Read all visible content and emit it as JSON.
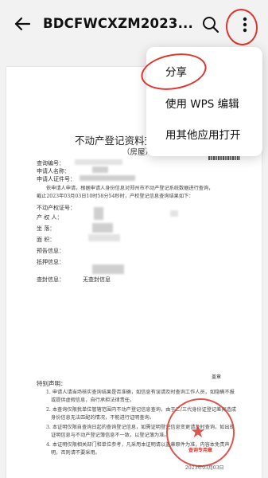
{
  "header": {
    "title": "BDCFWCXZM2023...",
    "back_icon": "arrow-left-icon",
    "search_icon": "search-icon",
    "more_icon": "more-vertical-icon"
  },
  "menu": {
    "items": [
      {
        "label": "分享"
      },
      {
        "label": "使用 WPS 编辑"
      },
      {
        "label": "用其他应用打开"
      }
    ]
  },
  "annotation_color": "#e0342c",
  "document": {
    "heading": "不动产登记资料查询",
    "subheading": "（房屋）",
    "fields": {
      "query_no": "查询编号：",
      "applicant": "申请人名称：",
      "id_no": "申请人证件号：",
      "cert_no": "不动产权证号：",
      "owner": "产    权    人：",
      "location": "坐          落：",
      "area": "面          积：",
      "presale": "预告信息：",
      "mortgage": "抵押信息：",
      "seizure": "查封信息：",
      "seizure_value": "无查封信息"
    },
    "intro_lines": [
      "依申请人申请，根据申请人身份信息对郑州市不动产登记系统数据进行查询，",
      "截止2023年03月03日10时58分54秒时，产权登记信息查询结果如下："
    ],
    "notes_title": "特别声明：",
    "notes": [
      "1. 申请人请当场核实查询结果是否准确，如信息有误请及时查询工作人员，如隐瞒不报",
      "或提供虚假信息，自行承担法律责任。",
      "2. 本查询仅限我单位管辖范围内不动产登记信息查询，由于二/三代身份证登记差异造成",
      "身份信息无法匹配的情况，不能进行证明查询。",
      "3. 本证明仅限自查询日起的查询登记信息，如需证明登记信息变更请及时查询，如出现",
      "证明信息与不动产登记簿信息不一致，以登记簿为准。",
      "4. 本证明仅限相关部门和单位参考，凡采用本证明请以盖章原件为准，内容本免责声",
      "明，否则请不要采用。"
    ],
    "seal_text": "查询专用章",
    "stamp_note": "盖章",
    "date": "2023年03月03日"
  }
}
